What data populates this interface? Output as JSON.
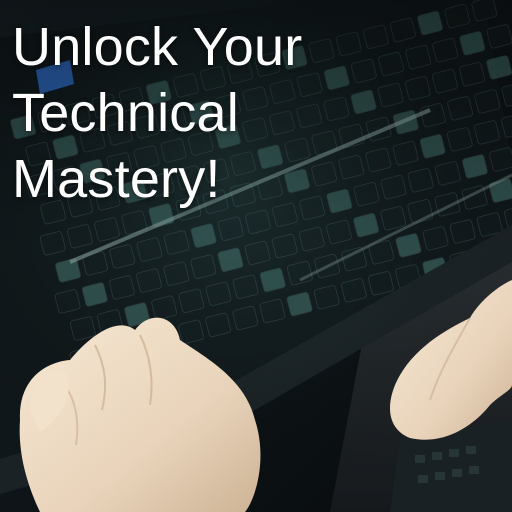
{
  "headline": {
    "line1": "Unlock Your",
    "line2": "Technical",
    "line3": "Mastery!"
  },
  "colors": {
    "text": "#ffffff",
    "background": "#0b0f12",
    "key_cap": "#11191c",
    "key_highlight": "#4a7f7a",
    "skin": "#efdcc5",
    "accent_blue": "#2b63b8"
  },
  "scene_elements": [
    "keyboard",
    "left-hand",
    "right-hand",
    "blue-tab-accent"
  ]
}
